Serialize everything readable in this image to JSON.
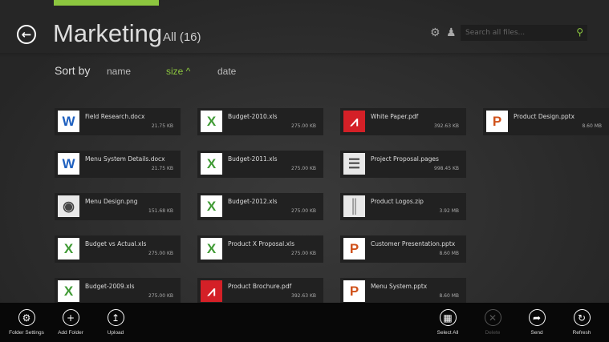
{
  "header": {
    "title": "Marketing",
    "filter": "All (16)",
    "search_placeholder": "Search all files..."
  },
  "sort": {
    "label": "Sort by",
    "options": [
      "name",
      "size ^",
      "date"
    ],
    "active": "size"
  },
  "accent": "#8cc63f",
  "files": [
    {
      "name": "Field Research.docx",
      "size": "21.75 KB",
      "icon": "word"
    },
    {
      "name": "Menu System Details.docx",
      "size": "21.75 KB",
      "icon": "word"
    },
    {
      "name": "Menu Design.png",
      "size": "151.68 KB",
      "icon": "camera"
    },
    {
      "name": "Budget vs Actual.xls",
      "size": "275.00 KB",
      "icon": "excel"
    },
    {
      "name": "Budget-2009.xls",
      "size": "275.00 KB",
      "icon": "excel"
    },
    {
      "name": "Budget-2010.xls",
      "size": "275.00 KB",
      "icon": "excel"
    },
    {
      "name": "Budget-2011.xls",
      "size": "275.00 KB",
      "icon": "excel"
    },
    {
      "name": "Budget-2012.xls",
      "size": "275.00 KB",
      "icon": "excel"
    },
    {
      "name": "Product X Proposal.xls",
      "size": "275.00 KB",
      "icon": "excel"
    },
    {
      "name": "Product Brochure.pdf",
      "size": "392.63 KB",
      "icon": "pdf"
    },
    {
      "name": "White Paper.pdf",
      "size": "392.63 KB",
      "icon": "pdf"
    },
    {
      "name": "Project Proposal.pages",
      "size": "998.45 KB",
      "icon": "document"
    },
    {
      "name": "Product Logos.zip",
      "size": "3.92 MB",
      "icon": "zip"
    },
    {
      "name": "Customer Presentation.pptx",
      "size": "8.60 MB",
      "icon": "powerpoint"
    },
    {
      "name": "Menu System.pptx",
      "size": "8.60 MB",
      "icon": "powerpoint"
    },
    {
      "name": "Product Design.pptx",
      "size": "8.60 MB",
      "icon": "powerpoint"
    }
  ],
  "appbar": {
    "left": [
      "Folder Settings",
      "Add Folder",
      "Upload"
    ],
    "right": [
      "Select All",
      "Delete",
      "Send",
      "Refresh"
    ]
  }
}
